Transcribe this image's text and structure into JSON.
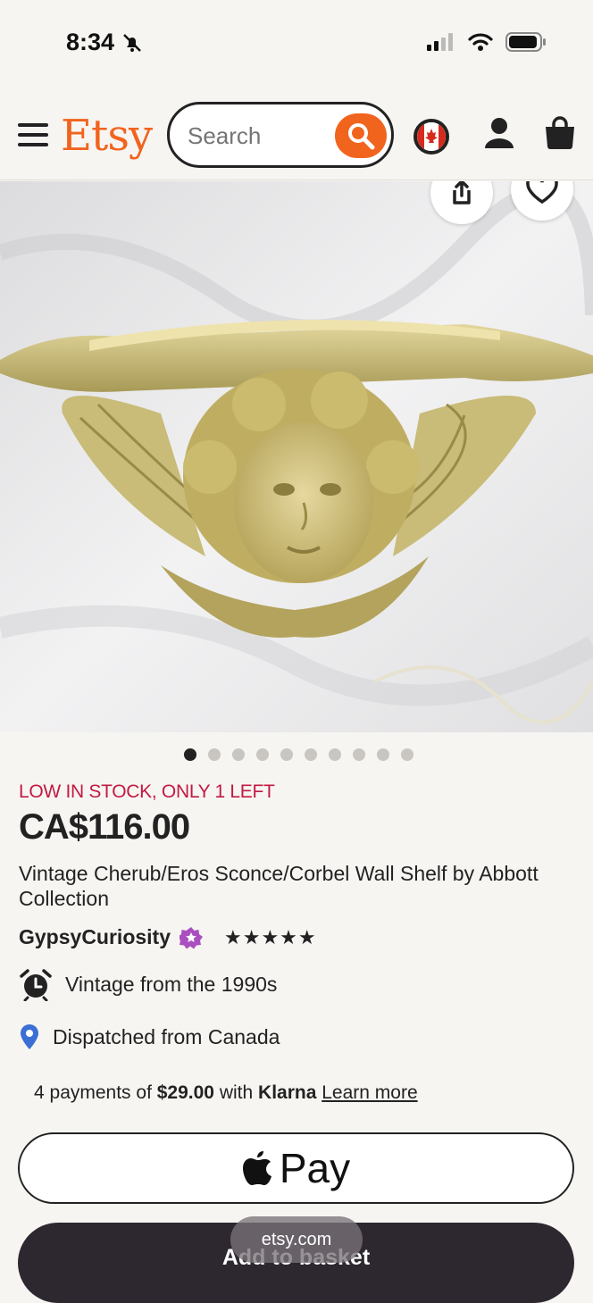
{
  "status_bar": {
    "time": "8:34"
  },
  "header": {
    "logo": "Etsy",
    "search_placeholder": "Search",
    "icons": [
      "menu-icon",
      "search-icon",
      "canada-flag-icon",
      "account-icon",
      "bag-icon"
    ]
  },
  "listing": {
    "image_count": 10,
    "active_image": 1,
    "stock_notice": "LOW IN STOCK, ONLY 1 LEFT",
    "price": "CA$116.00",
    "title": "Vintage Cherub/Eros Sconce/Corbel Wall Shelf by Abbott Collection",
    "seller": "GypsyCuriosity",
    "rating_stars": "★★★★★",
    "rating": 5,
    "feature_vintage": "Vintage from the 1990s",
    "feature_dispatch": "Dispatched from Canada"
  },
  "klarna": {
    "prefix": "4 payments of",
    "amount": "$29.00",
    "mid": "with",
    "brand": "Klarna",
    "link": "Learn more"
  },
  "buttons": {
    "apple_pay": "Pay",
    "add_to_basket": "Add to basket"
  },
  "browser": {
    "url": "etsy.com"
  },
  "colors": {
    "brand": "#f1641e",
    "stock": "#c21a42",
    "basket_bg": "#2d2730"
  }
}
